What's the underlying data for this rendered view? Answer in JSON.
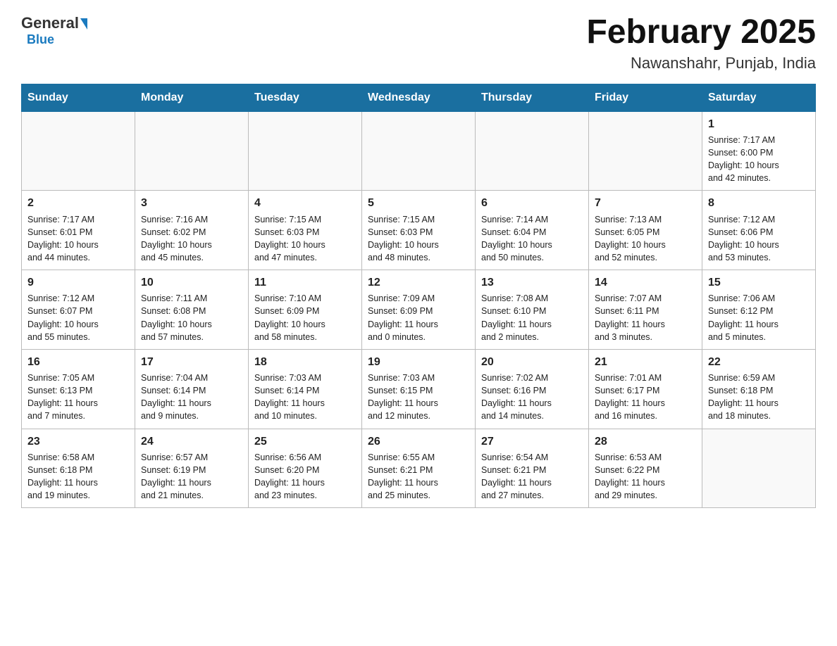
{
  "header": {
    "logo_general": "General",
    "logo_blue": "Blue",
    "title": "February 2025",
    "subtitle": "Nawanshahr, Punjab, India"
  },
  "weekdays": [
    "Sunday",
    "Monday",
    "Tuesday",
    "Wednesday",
    "Thursday",
    "Friday",
    "Saturday"
  ],
  "weeks": [
    [
      {
        "day": "",
        "info": ""
      },
      {
        "day": "",
        "info": ""
      },
      {
        "day": "",
        "info": ""
      },
      {
        "day": "",
        "info": ""
      },
      {
        "day": "",
        "info": ""
      },
      {
        "day": "",
        "info": ""
      },
      {
        "day": "1",
        "info": "Sunrise: 7:17 AM\nSunset: 6:00 PM\nDaylight: 10 hours\nand 42 minutes."
      }
    ],
    [
      {
        "day": "2",
        "info": "Sunrise: 7:17 AM\nSunset: 6:01 PM\nDaylight: 10 hours\nand 44 minutes."
      },
      {
        "day": "3",
        "info": "Sunrise: 7:16 AM\nSunset: 6:02 PM\nDaylight: 10 hours\nand 45 minutes."
      },
      {
        "day": "4",
        "info": "Sunrise: 7:15 AM\nSunset: 6:03 PM\nDaylight: 10 hours\nand 47 minutes."
      },
      {
        "day": "5",
        "info": "Sunrise: 7:15 AM\nSunset: 6:03 PM\nDaylight: 10 hours\nand 48 minutes."
      },
      {
        "day": "6",
        "info": "Sunrise: 7:14 AM\nSunset: 6:04 PM\nDaylight: 10 hours\nand 50 minutes."
      },
      {
        "day": "7",
        "info": "Sunrise: 7:13 AM\nSunset: 6:05 PM\nDaylight: 10 hours\nand 52 minutes."
      },
      {
        "day": "8",
        "info": "Sunrise: 7:12 AM\nSunset: 6:06 PM\nDaylight: 10 hours\nand 53 minutes."
      }
    ],
    [
      {
        "day": "9",
        "info": "Sunrise: 7:12 AM\nSunset: 6:07 PM\nDaylight: 10 hours\nand 55 minutes."
      },
      {
        "day": "10",
        "info": "Sunrise: 7:11 AM\nSunset: 6:08 PM\nDaylight: 10 hours\nand 57 minutes."
      },
      {
        "day": "11",
        "info": "Sunrise: 7:10 AM\nSunset: 6:09 PM\nDaylight: 10 hours\nand 58 minutes."
      },
      {
        "day": "12",
        "info": "Sunrise: 7:09 AM\nSunset: 6:09 PM\nDaylight: 11 hours\nand 0 minutes."
      },
      {
        "day": "13",
        "info": "Sunrise: 7:08 AM\nSunset: 6:10 PM\nDaylight: 11 hours\nand 2 minutes."
      },
      {
        "day": "14",
        "info": "Sunrise: 7:07 AM\nSunset: 6:11 PM\nDaylight: 11 hours\nand 3 minutes."
      },
      {
        "day": "15",
        "info": "Sunrise: 7:06 AM\nSunset: 6:12 PM\nDaylight: 11 hours\nand 5 minutes."
      }
    ],
    [
      {
        "day": "16",
        "info": "Sunrise: 7:05 AM\nSunset: 6:13 PM\nDaylight: 11 hours\nand 7 minutes."
      },
      {
        "day": "17",
        "info": "Sunrise: 7:04 AM\nSunset: 6:14 PM\nDaylight: 11 hours\nand 9 minutes."
      },
      {
        "day": "18",
        "info": "Sunrise: 7:03 AM\nSunset: 6:14 PM\nDaylight: 11 hours\nand 10 minutes."
      },
      {
        "day": "19",
        "info": "Sunrise: 7:03 AM\nSunset: 6:15 PM\nDaylight: 11 hours\nand 12 minutes."
      },
      {
        "day": "20",
        "info": "Sunrise: 7:02 AM\nSunset: 6:16 PM\nDaylight: 11 hours\nand 14 minutes."
      },
      {
        "day": "21",
        "info": "Sunrise: 7:01 AM\nSunset: 6:17 PM\nDaylight: 11 hours\nand 16 minutes."
      },
      {
        "day": "22",
        "info": "Sunrise: 6:59 AM\nSunset: 6:18 PM\nDaylight: 11 hours\nand 18 minutes."
      }
    ],
    [
      {
        "day": "23",
        "info": "Sunrise: 6:58 AM\nSunset: 6:18 PM\nDaylight: 11 hours\nand 19 minutes."
      },
      {
        "day": "24",
        "info": "Sunrise: 6:57 AM\nSunset: 6:19 PM\nDaylight: 11 hours\nand 21 minutes."
      },
      {
        "day": "25",
        "info": "Sunrise: 6:56 AM\nSunset: 6:20 PM\nDaylight: 11 hours\nand 23 minutes."
      },
      {
        "day": "26",
        "info": "Sunrise: 6:55 AM\nSunset: 6:21 PM\nDaylight: 11 hours\nand 25 minutes."
      },
      {
        "day": "27",
        "info": "Sunrise: 6:54 AM\nSunset: 6:21 PM\nDaylight: 11 hours\nand 27 minutes."
      },
      {
        "day": "28",
        "info": "Sunrise: 6:53 AM\nSunset: 6:22 PM\nDaylight: 11 hours\nand 29 minutes."
      },
      {
        "day": "",
        "info": ""
      }
    ]
  ],
  "colors": {
    "header_bg": "#1a6fa0",
    "header_text": "#ffffff",
    "border": "#aaaaaa"
  }
}
